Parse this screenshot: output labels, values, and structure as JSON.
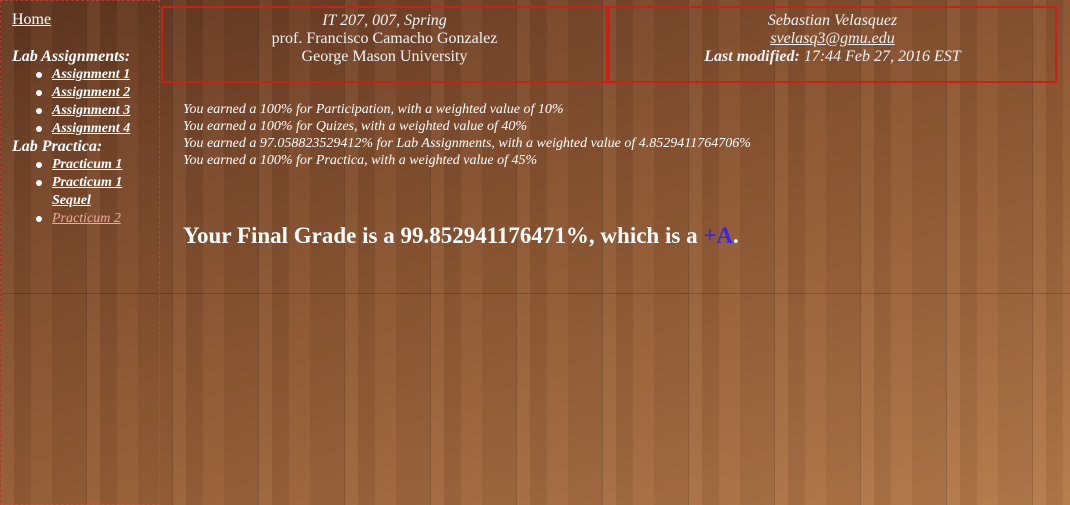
{
  "sidebar": {
    "home": "Home",
    "lab_assignments_heading": "Lab Assignments:",
    "lab_assignments": [
      "Assignment 1",
      "Assignment 2",
      "Assignment 3",
      "Assignment 4"
    ],
    "lab_practica_heading": "Lab Practica:",
    "lab_practica": [
      "Practicum 1",
      "Practicum 1 Sequel",
      "Practicum 2"
    ],
    "current_item": "Practicum 2"
  },
  "course_box": {
    "course": "IT 207, 007, Spring",
    "professor": "prof. Francisco Camacho Gonzalez",
    "university": "George Mason University"
  },
  "student_box": {
    "name": "Sebastian Velasquez",
    "email": "svelasq3@gmu.edu",
    "last_modified_label": "Last modified:",
    "last_modified_value": "17:44 Feb 27, 2016 EST"
  },
  "grades": [
    "You earned a 100% for Participation, with a weighted value of 10%",
    "You earned a 100% for Quizes, with a weighted value of 40%",
    "You earned a 97.058823529412% for Lab Assignments, with a weighted value of 4.8529411764706%",
    "You earned a 100% for Practica, with a weighted value of 45%"
  ],
  "final": {
    "prefix": "Your Final Grade is a 99.852941176471%, which is a ",
    "letter": "+A",
    "suffix": "."
  },
  "colors": {
    "letter_grade": "#3a25e8",
    "box_border": "#cc2016",
    "current_link": "#f2a7a7"
  }
}
